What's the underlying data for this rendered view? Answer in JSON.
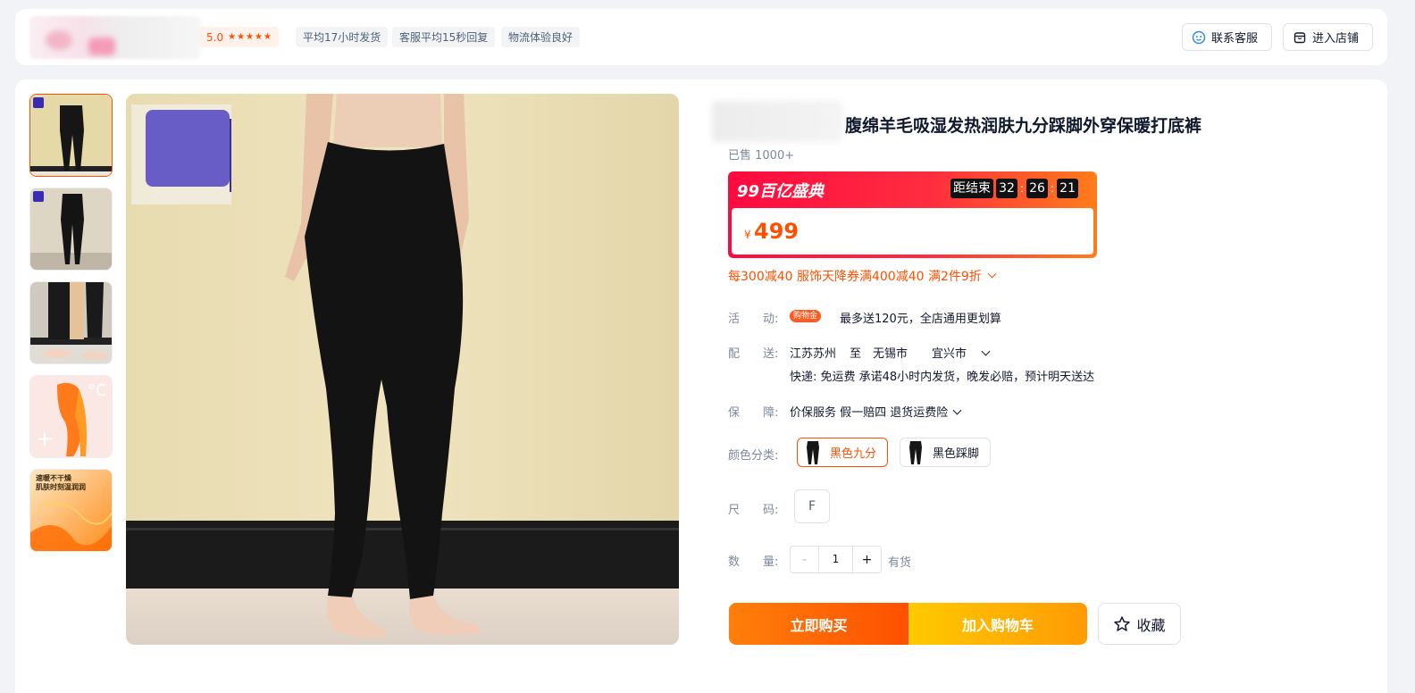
{
  "shop": {
    "name_fragment": "&",
    "rating": "5.0",
    "stars": 5,
    "chips": [
      "平均17小时发货",
      "客服平均15秒回复",
      "物流体验良好"
    ],
    "contact_label": "联系客服",
    "store_label": "进入店铺"
  },
  "product": {
    "title": "腹绵羊毛吸湿发热润肤九分踩脚外穿保暖打底裤",
    "sold": "已售 1000+",
    "thumbnails": [
      {
        "name": "thumb-black-leggings-front"
      },
      {
        "name": "thumb-black-leggings-side"
      },
      {
        "name": "thumb-fleece-lining"
      },
      {
        "name": "thumb-thermal-heat"
      },
      {
        "name": "thumb-moisture-promo",
        "text": "速暖不干燥\n肌肤时刻温润润"
      }
    ]
  },
  "promo": {
    "event": "99百亿盛典",
    "countdown_label": "距结束",
    "hours": "32",
    "minutes": "26",
    "seconds": "21",
    "currency": "¥",
    "price": "499",
    "coupons": "每300减40 服饰天降券满400减40 满2件9折"
  },
  "details": {
    "activity_label": "活　　动:",
    "activity_badge": "购物金",
    "activity_text": "最多送120元，全店通用更划算",
    "delivery_label": "配　　送:",
    "delivery_from": "江苏苏州",
    "delivery_to_word": "至",
    "delivery_city": "无锡市",
    "delivery_district": "宜兴市",
    "delivery_note": "快递: 免运费  承诺48小时内发货，晚发必赔，预计明天送达",
    "guarantee_label": "保　　障:",
    "guarantee_text": "价保服务 假一赔四 退货运费险",
    "color_label": "颜色分类:",
    "colors": [
      "黑色九分",
      "黑色踩脚"
    ],
    "selected_color": 0,
    "size_label": "尺　　码:",
    "size": "F",
    "qty_label": "数　　量:",
    "qty": "1",
    "minus": "-",
    "plus": "+",
    "stock": "有货"
  },
  "actions": {
    "buy_now": "立即购买",
    "add_cart": "加入购物车",
    "favorite": "收藏"
  },
  "colors": {
    "accent": "#ff5000",
    "promo_red": "#ff0a40",
    "cart_yellow": "#ffca00"
  }
}
